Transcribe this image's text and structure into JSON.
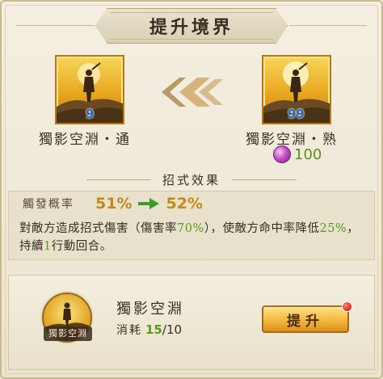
{
  "dialog": {
    "title": "提升境界"
  },
  "current_skill": {
    "name": "獨影空淵・通",
    "level": "9"
  },
  "next_skill": {
    "name": "獨影空淵・熟",
    "level": "99",
    "cost": "100"
  },
  "effect": {
    "section_title": "招式效果",
    "stat_label": "觸發概率",
    "stat_old": "51%",
    "stat_new": "52%",
    "desc_part1": "對敵方造成招式傷害（傷害率",
    "desc_rate": "70%",
    "desc_part2": "），使敵方命中率降低",
    "desc_reduce": "25%",
    "desc_part3": "，持續",
    "desc_turns": "1",
    "desc_part4": "行動回合。"
  },
  "material": {
    "icon_label": "獨影空淵",
    "name": "獨影空淵",
    "consume_label": "消耗",
    "have": "15",
    "sep": "/",
    "need": "10"
  },
  "actions": {
    "upgrade_label": "提升"
  },
  "colors": {
    "accent_gold": "#f3b73d",
    "highlight_green": "#5a9a1e",
    "stat_orange": "#c58a1a",
    "notification_red": "#e2321f"
  }
}
